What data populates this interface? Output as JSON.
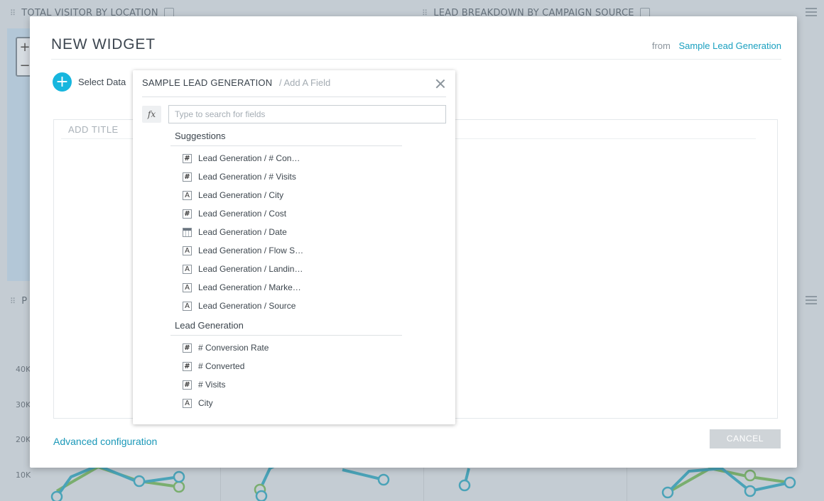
{
  "background": {
    "left_panel_title": "TOTAL VISITOR BY LOCATION",
    "right_panel_title": "LEAD BREAKDOWN BY CAMPAIGN SOURCE",
    "y_axis_ticks": [
      "40K",
      "30K",
      "20K",
      "10K"
    ],
    "lower_panel_letter": "P",
    "map_zoom_in": "+",
    "map_zoom_out": "−"
  },
  "modal": {
    "title": "NEW WIDGET",
    "from_word": "from",
    "source_link": "Sample Lead Generation",
    "select_data_label": "Select Data",
    "add_title_placeholder": "ADD TITLE",
    "advanced_config_label": "Advanced configuration",
    "cancel_label": "CANCEL"
  },
  "picker": {
    "datasource": "SAMPLE LEAD GENERATION",
    "separator_text": "/ Add A Field",
    "fx_label": "fx",
    "search_placeholder": "Type to search for fields",
    "groups": [
      {
        "title": "Suggestions",
        "fields": [
          {
            "type": "number",
            "icon": "#",
            "label": "Lead Generation / # Con…"
          },
          {
            "type": "number",
            "icon": "#",
            "label": "Lead Generation / # Visits"
          },
          {
            "type": "text",
            "icon": "A",
            "label": "Lead Generation / City"
          },
          {
            "type": "number",
            "icon": "#",
            "label": "Lead Generation / Cost"
          },
          {
            "type": "date",
            "icon": "",
            "label": "Lead Generation / Date"
          },
          {
            "type": "text",
            "icon": "A",
            "label": "Lead Generation / Flow S…"
          },
          {
            "type": "text",
            "icon": "A",
            "label": "Lead Generation / Landin…"
          },
          {
            "type": "text",
            "icon": "A",
            "label": "Lead Generation / Marke…"
          },
          {
            "type": "text",
            "icon": "A",
            "label": "Lead Generation / Source"
          }
        ]
      },
      {
        "title": "Lead Generation",
        "fields": [
          {
            "type": "number",
            "icon": "#",
            "label": "# Conversion Rate"
          },
          {
            "type": "number",
            "icon": "#",
            "label": "# Converted"
          },
          {
            "type": "number",
            "icon": "#",
            "label": "# Visits"
          },
          {
            "type": "text",
            "icon": "A",
            "label": "City"
          }
        ]
      }
    ]
  },
  "colors": {
    "accent": "#17b6de",
    "link": "#1a98b8",
    "cancel_bg": "#cfd4d8",
    "bg_line_blue": "#4aa3b8",
    "bg_line_green": "#7aae6e"
  }
}
